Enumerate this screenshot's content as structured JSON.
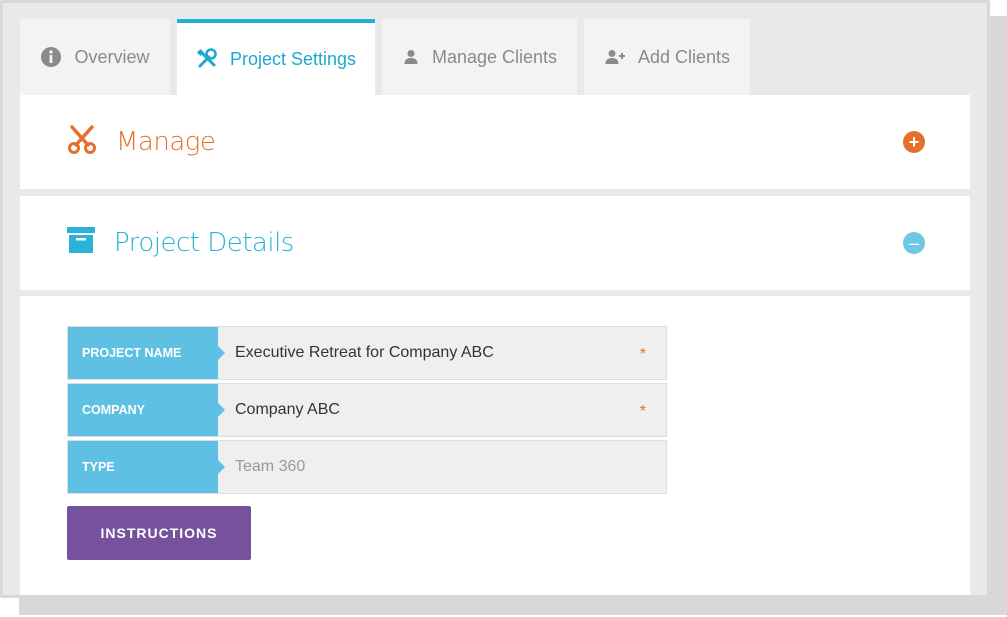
{
  "tabs": [
    {
      "label": "Overview",
      "icon": "info-icon",
      "active": false
    },
    {
      "label": "Project Settings",
      "icon": "tools-icon",
      "active": true
    },
    {
      "label": "Manage Clients",
      "icon": "user-icon",
      "active": false
    },
    {
      "label": "Add Clients",
      "icon": "add-user-icon",
      "active": false
    }
  ],
  "sections": {
    "manage": {
      "title": "Manage",
      "icon": "scissors-icon",
      "toggle": "expand"
    },
    "details": {
      "title": "Project Details",
      "icon": "archive-box-icon",
      "toggle": "collapse"
    }
  },
  "form": {
    "fields": [
      {
        "label": "PROJECT NAME",
        "value": "Executive Retreat for Company ABC",
        "required_mark": "*"
      },
      {
        "label": "COMPANY",
        "value": "Company ABC",
        "required_mark": "*"
      },
      {
        "label": "TYPE",
        "value": "Team 360"
      }
    ],
    "instructions_button": "INSTRUCTIONS"
  },
  "colors": {
    "accent_blue": "#1fb0d4",
    "label_blue": "#5ec1e4",
    "orange": "#e4702c",
    "purple": "#76529c"
  }
}
